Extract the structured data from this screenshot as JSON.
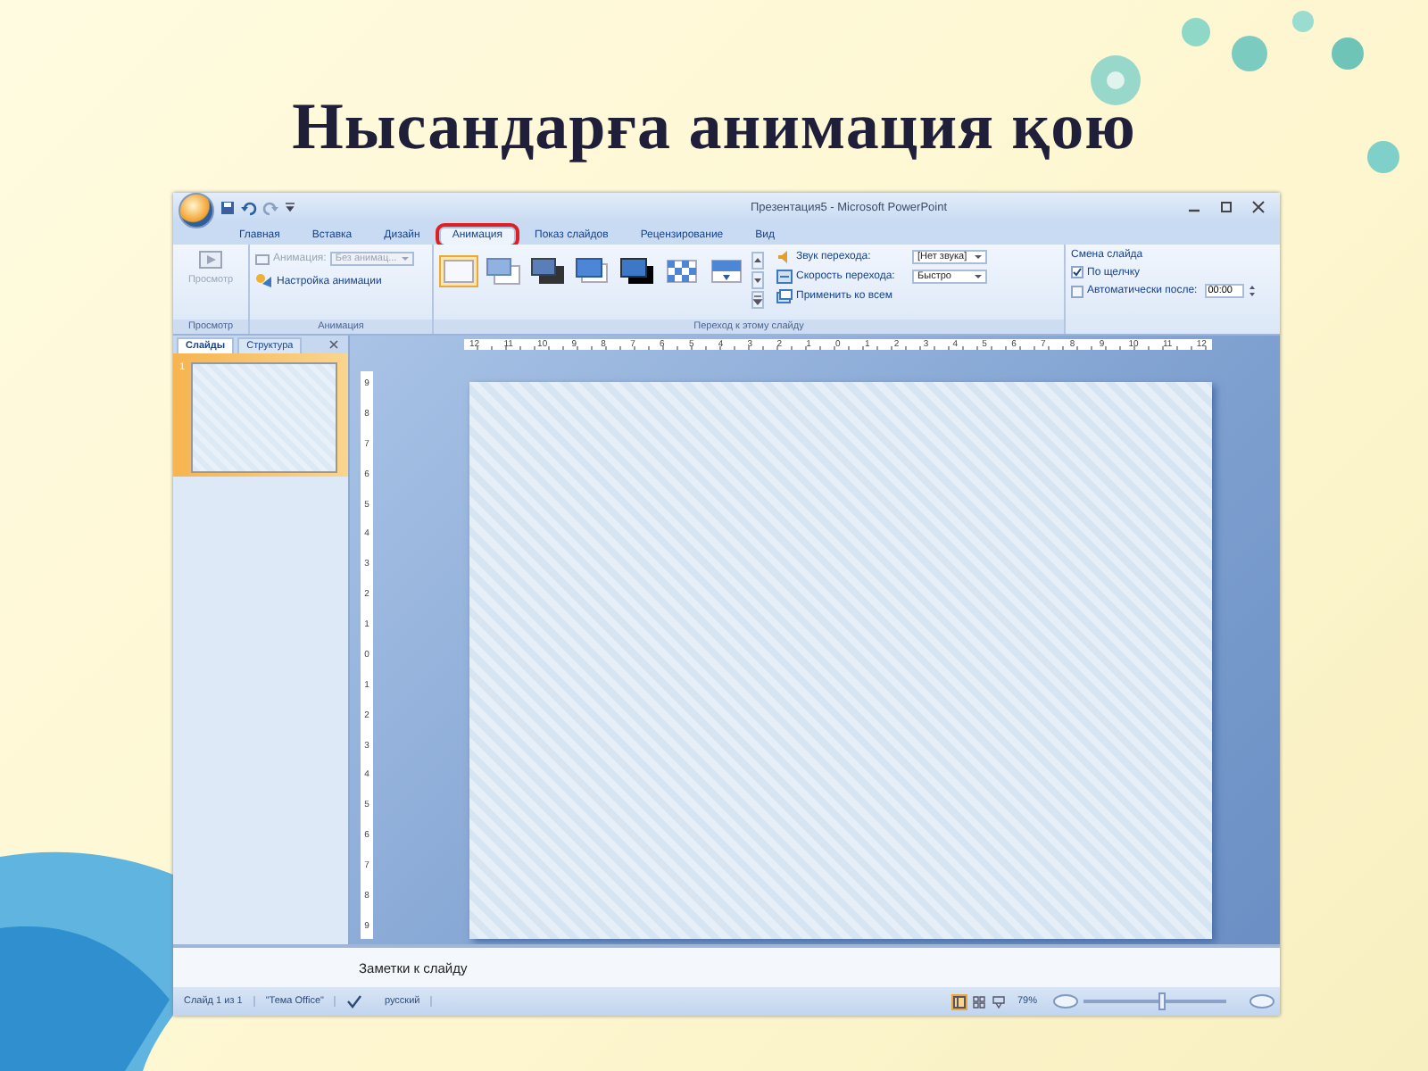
{
  "title": "Нысандарға анимация қою",
  "window": {
    "title": "Презентация5 - Microsoft PowerPoint"
  },
  "ribbon_tabs": [
    {
      "label": "Главная",
      "selected": false,
      "highlighted": false
    },
    {
      "label": "Вставка",
      "selected": false,
      "highlighted": false
    },
    {
      "label": "Дизайн",
      "selected": false,
      "highlighted": false
    },
    {
      "label": "Анимация",
      "selected": true,
      "highlighted": true
    },
    {
      "label": "Показ слайдов",
      "selected": false,
      "highlighted": false
    },
    {
      "label": "Рецензирование",
      "selected": false,
      "highlighted": false
    },
    {
      "label": "Вид",
      "selected": false,
      "highlighted": false
    }
  ],
  "ribbon": {
    "preview_group": {
      "button": "Просмотр",
      "disabled": true,
      "label": "Просмотр"
    },
    "animation_group": {
      "animation_label": "Анимация:",
      "animation_value": "Без анимац...",
      "disabled": true,
      "custom_animation": "Настройка анимации",
      "label": "Анимация"
    },
    "transition_group": {
      "gallery": [
        {
          "kind": "plain",
          "selected": true
        },
        {
          "kind": "light",
          "selected": false
        },
        {
          "kind": "dark",
          "selected": false
        },
        {
          "kind": "blue",
          "selected": false
        },
        {
          "kind": "black",
          "selected": false
        },
        {
          "kind": "checker",
          "selected": false
        },
        {
          "kind": "wipe",
          "selected": false
        }
      ],
      "sound_label": "Звук перехода:",
      "sound_value": "[Нет звука]",
      "speed_label": "Скорость перехода:",
      "speed_value": "Быстро",
      "apply_all": "Применить ко всем",
      "label": "Переход к этому слайду"
    },
    "advance_group": {
      "title": "Смена слайда",
      "on_click": {
        "label": "По щелчку",
        "checked": true
      },
      "after": {
        "label": "Автоматически после:",
        "checked": false,
        "value": "00:00"
      }
    }
  },
  "pane_tabs": [
    {
      "label": "Слайды",
      "selected": true
    },
    {
      "label": "Структура",
      "selected": false
    }
  ],
  "slide_thumbnails": [
    {
      "number": "1",
      "selected": true
    }
  ],
  "horizontal_ruler": [
    "12",
    "11",
    "10",
    "9",
    "8",
    "7",
    "6",
    "5",
    "4",
    "3",
    "2",
    "1",
    "0",
    "1",
    "2",
    "3",
    "4",
    "5",
    "6",
    "7",
    "8",
    "9",
    "10",
    "11",
    "12"
  ],
  "vertical_ruler": [
    "9",
    "8",
    "7",
    "6",
    "5",
    "4",
    "3",
    "2",
    "1",
    "0",
    "1",
    "2",
    "3",
    "4",
    "5",
    "6",
    "7",
    "8",
    "9"
  ],
  "notes": {
    "placeholder": "Заметки к слайду"
  },
  "status_bar": {
    "slide": "Слайд 1 из 1",
    "theme": "\"Тема Office\"",
    "language": "русский",
    "views": [
      {
        "selected": true
      },
      {
        "selected": false
      },
      {
        "selected": false
      }
    ],
    "zoom": "79%",
    "level": 0.55
  }
}
